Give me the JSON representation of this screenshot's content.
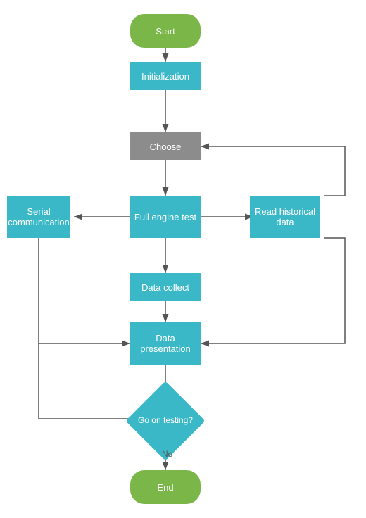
{
  "nodes": {
    "start": {
      "label": "Start"
    },
    "initialization": {
      "label": "Initialization"
    },
    "choose": {
      "label": "Choose"
    },
    "serial_communication": {
      "label": "Serial communication"
    },
    "full_engine_test": {
      "label": "Full engine test"
    },
    "read_historical_data": {
      "label": "Read historical data"
    },
    "data_collect": {
      "label": "Data collect"
    },
    "data_presentation": {
      "label": "Data presentation"
    },
    "go_on_testing": {
      "label": "Go on testing?"
    },
    "no_label": {
      "label": "No"
    },
    "end": {
      "label": "End"
    }
  }
}
